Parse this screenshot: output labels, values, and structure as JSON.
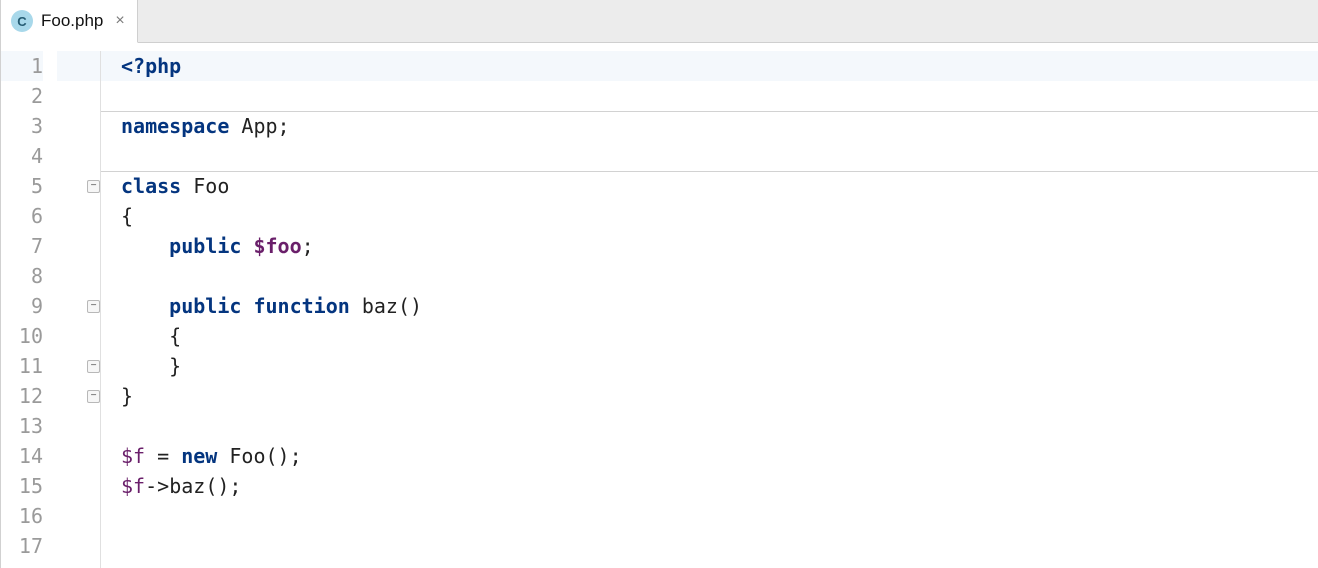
{
  "tab": {
    "icon_letter": "C",
    "filename": "Foo.php",
    "close_glyph": "×"
  },
  "editor": {
    "line_numbers": [
      "1",
      "2",
      "3",
      "4",
      "5",
      "6",
      "7",
      "8",
      "9",
      "10",
      "11",
      "12",
      "13",
      "14",
      "15",
      "16",
      "17"
    ],
    "highlighted_line": 1,
    "fold_markers": [
      {
        "line": 5,
        "type": "open"
      },
      {
        "line": 9,
        "type": "open"
      },
      {
        "line": 11,
        "type": "close"
      },
      {
        "line": 12,
        "type": "close"
      }
    ],
    "separators_after_line": [
      2,
      4
    ],
    "code_lines": [
      {
        "tokens": [
          {
            "t": "<?php",
            "c": "kw"
          }
        ]
      },
      {
        "tokens": []
      },
      {
        "tokens": [
          {
            "t": "namespace ",
            "c": "kw"
          },
          {
            "t": "App",
            "c": "txt"
          },
          {
            "t": ";",
            "c": "punct"
          }
        ]
      },
      {
        "tokens": []
      },
      {
        "tokens": [
          {
            "t": "class ",
            "c": "kw"
          },
          {
            "t": "Foo",
            "c": "cls"
          }
        ]
      },
      {
        "tokens": [
          {
            "t": "{",
            "c": "punct"
          }
        ]
      },
      {
        "tokens": [
          {
            "t": "    ",
            "c": "txt"
          },
          {
            "t": "public ",
            "c": "kw"
          },
          {
            "t": "$foo",
            "c": "varb"
          },
          {
            "t": ";",
            "c": "punct"
          }
        ]
      },
      {
        "tokens": []
      },
      {
        "tokens": [
          {
            "t": "    ",
            "c": "txt"
          },
          {
            "t": "public function ",
            "c": "kw"
          },
          {
            "t": "baz",
            "c": "func"
          },
          {
            "t": "()",
            "c": "punct"
          }
        ]
      },
      {
        "tokens": [
          {
            "t": "    {",
            "c": "punct"
          }
        ]
      },
      {
        "tokens": [
          {
            "t": "    }",
            "c": "punct"
          }
        ]
      },
      {
        "tokens": [
          {
            "t": "}",
            "c": "punct"
          }
        ]
      },
      {
        "tokens": []
      },
      {
        "tokens": [
          {
            "t": "$f",
            "c": "var"
          },
          {
            "t": " = ",
            "c": "op"
          },
          {
            "t": "new ",
            "c": "kw"
          },
          {
            "t": "Foo",
            "c": "cls"
          },
          {
            "t": "();",
            "c": "punct"
          }
        ]
      },
      {
        "tokens": [
          {
            "t": "$f",
            "c": "var"
          },
          {
            "t": "->",
            "c": "op"
          },
          {
            "t": "baz",
            "c": "func"
          },
          {
            "t": "();",
            "c": "punct"
          }
        ]
      },
      {
        "tokens": []
      },
      {
        "tokens": []
      }
    ]
  }
}
